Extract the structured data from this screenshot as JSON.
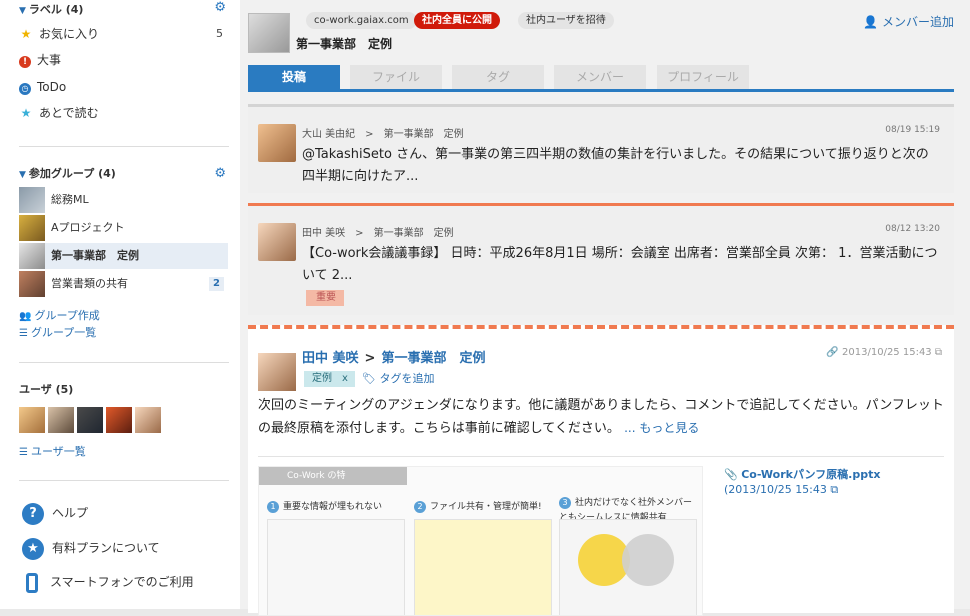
{
  "sidebar": {
    "labels": {
      "title": "ラベル (4)",
      "items": [
        {
          "label": "お気に入り",
          "count": "5",
          "icon": "star-icon",
          "color": "#f0b400"
        },
        {
          "label": "大事",
          "count": "",
          "icon": "exclamation-icon",
          "color": "#d83a1e"
        },
        {
          "label": "ToDo",
          "count": "",
          "icon": "clock-icon",
          "color": "#2a78c0"
        },
        {
          "label": "あとで読む",
          "count": "",
          "icon": "star-icon",
          "color": "#3ab0d8"
        }
      ]
    },
    "groups": {
      "title": "参加グループ (4)",
      "items": [
        {
          "name": "総務ML",
          "badge": ""
        },
        {
          "name": "Aプロジェクト",
          "badge": ""
        },
        {
          "name": "第一事業部　定例",
          "badge": ""
        },
        {
          "name": "営業書類の共有",
          "badge": "2"
        }
      ],
      "create_link": "グループ作成",
      "list_link": "グループ一覧"
    },
    "users": {
      "title": "ユーザ (5)",
      "list_link": "ユーザ一覧"
    },
    "footer": {
      "help": "ヘルプ",
      "paid_plan": "有料プランについて",
      "smartphone": "スマートフォンでのご利用"
    }
  },
  "header": {
    "domain_chip": "co-work.gaiax.com",
    "public_chip": "社内全員に公開",
    "invite_chip": "社内ユーザを招待",
    "title": "第一事業部　定例",
    "add_member": "メンバー追加"
  },
  "tabs": [
    "投稿",
    "ファイル",
    "タグ",
    "メンバー",
    "プロフィール"
  ],
  "posts": [
    {
      "author": "大山 美由紀",
      "group": "第一事業部　定例",
      "time": "08/19 15:19",
      "body": "@TakashiSeto さん、第一事業の第三四半期の数値の集計を行いました。その結果について振り返りと次の四半期に向けたア...",
      "tag": ""
    },
    {
      "author": "田中 美咲",
      "group": "第一事業部　定例",
      "time": "08/12 13:20",
      "body": "【Co-work会議議事録】 日時：平成26年8月1日 場所：会議室 出席者：営業部全員 次第： 1．営業活動について 2...",
      "tag": "重要"
    }
  ],
  "detail": {
    "author": "田中 美咲",
    "group": "第一事業部　定例",
    "time": "2013/10/25 15:43",
    "tag": "定例",
    "tag_remove": "x",
    "add_tag": "タグを追加",
    "body": "次回のミーティングのアジェンダになります。他に議題がありましたら、コメントで追記してください。パンフレットの最終原稿を添付します。こちらは事前に確認してください。",
    "more": "... もっと見る",
    "attachment_name": "Co-Workパンフ原稿.pptx",
    "attachment_date": "(2013/10/25 15:43",
    "pamphlet": {
      "header": "Co-Work の特",
      "col1": "重要な情報が埋もれない",
      "col2": "ファイル共有・管理が簡単!",
      "col3": "社内だけでなく社外メンバーともシームレスに情報共有"
    }
  },
  "colors": {
    "accent": "#2a7bc1",
    "important_red": "#d01a0a",
    "highlight_orange": "#f07a50"
  }
}
